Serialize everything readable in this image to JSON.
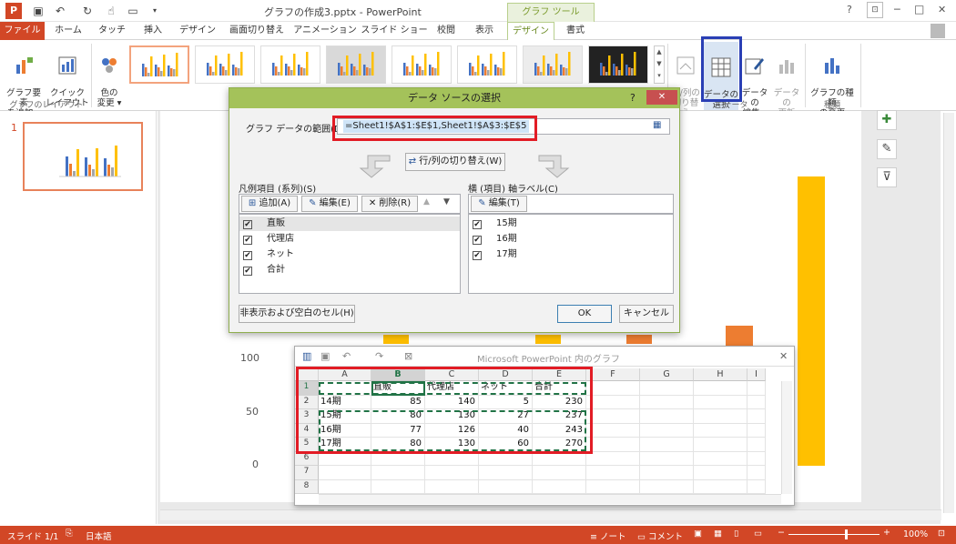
{
  "window": {
    "title": "グラフの作成3.pptx - PowerPoint",
    "help": "?",
    "min": "─",
    "max": "□",
    "close": "✕"
  },
  "context_tab_group": "グラフ ツール",
  "tabs": [
    "ファイル",
    "ホーム",
    "タッチ",
    "挿入",
    "デザイン",
    "画面切り替え",
    "アニメーション",
    "スライド ショー",
    "校閲",
    "表示",
    "デザイン",
    "書式"
  ],
  "ribbon": {
    "add_element": "グラフ要素\nを追加 ▾",
    "quick_layout": "クイック\nレイアウト ▾",
    "change_color": "色の\n変更 ▾",
    "group_layout": "グラフのレイアウト",
    "switch_rowcol": "行/列の\n切り替え",
    "select_data": "データの\n選択",
    "edit_data": "データの\n編集 ▾",
    "refresh_data": "データの\n更新",
    "change_type": "グラフの種類\nの変更",
    "group_data": "データ",
    "group_type": "種類"
  },
  "slide_panel": {
    "slide_number": "1"
  },
  "dialog": {
    "title": "データ ソースの選択",
    "help": "?",
    "close": "✕",
    "range_label": "グラフ データの範囲(D):",
    "range_value": "=Sheet1!$A$1:$E$1,Sheet1!$A$3:$E$5",
    "switch_button": "行/列の切り替え(W)",
    "legend_label": "凡例項目 (系列)(S)",
    "axis_label": "横 (項目) 軸ラベル(C)",
    "add_button": "追加(A)",
    "edit_button": "編集(E)",
    "delete_button": "削除(R)",
    "axis_edit_button": "編集(T)",
    "series": [
      "直販",
      "代理店",
      "ネット",
      "合計"
    ],
    "categories": [
      "15期",
      "16期",
      "17期"
    ],
    "hidden_cells_button": "非表示および空白のセル(H)",
    "ok_button": "OK",
    "cancel_button": "キャンセル"
  },
  "sheet": {
    "title": "Microsoft PowerPoint 内のグラフ",
    "close": "✕",
    "columns": [
      "A",
      "B",
      "C",
      "D",
      "E",
      "F",
      "G",
      "H",
      "I"
    ],
    "rows": [
      [
        "",
        "直販",
        "代理店",
        "ネット",
        "合計"
      ],
      [
        "14期",
        "85",
        "140",
        "5",
        "230"
      ],
      [
        "15期",
        "80",
        "130",
        "27",
        "237"
      ],
      [
        "16期",
        "77",
        "126",
        "40",
        "243"
      ],
      [
        "17期",
        "80",
        "130",
        "60",
        "270"
      ]
    ],
    "row_numbers": [
      "1",
      "2",
      "3",
      "4",
      "5",
      "6",
      "7",
      "8"
    ]
  },
  "axis_ticks": [
    "100",
    "50",
    "0"
  ],
  "status": {
    "slide": "スライド 1/1",
    "lang": "日本語",
    "notes": "ノート",
    "comments": "コメント",
    "zoom": "100%"
  },
  "colors": {
    "ppt_orange": "#d24726",
    "ribbon_green": "#a4c25a",
    "chart_gold": "#ffc000",
    "chart_orange": "#ed7d31",
    "highlight_red": "#e21c25",
    "highlight_blue": "#2a3fb5"
  }
}
